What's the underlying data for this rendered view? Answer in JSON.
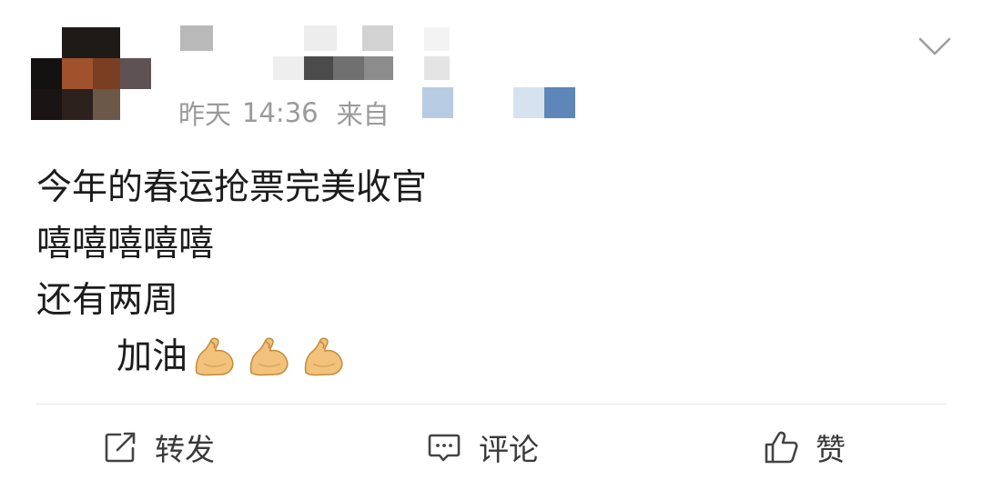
{
  "post": {
    "meta": {
      "date": "昨天",
      "time": "14:36",
      "source_prefix": "来自"
    },
    "content_lines": [
      "今年的春运抢票完美收官",
      "嘻嘻嘻嘻嘻",
      "还有两周",
      "加油"
    ],
    "emojis": [
      "flexed-biceps-icon",
      "flexed-biceps-icon",
      "flexed-biceps-icon"
    ],
    "actions": {
      "repost_label": "转发",
      "comment_label": "评论",
      "like_label": "赞"
    },
    "colors": {
      "meta_text": "#9a9a9a",
      "body_text": "#1c1c1c",
      "action_text": "#3a3a3a",
      "divider": "#e6e6e6"
    }
  }
}
